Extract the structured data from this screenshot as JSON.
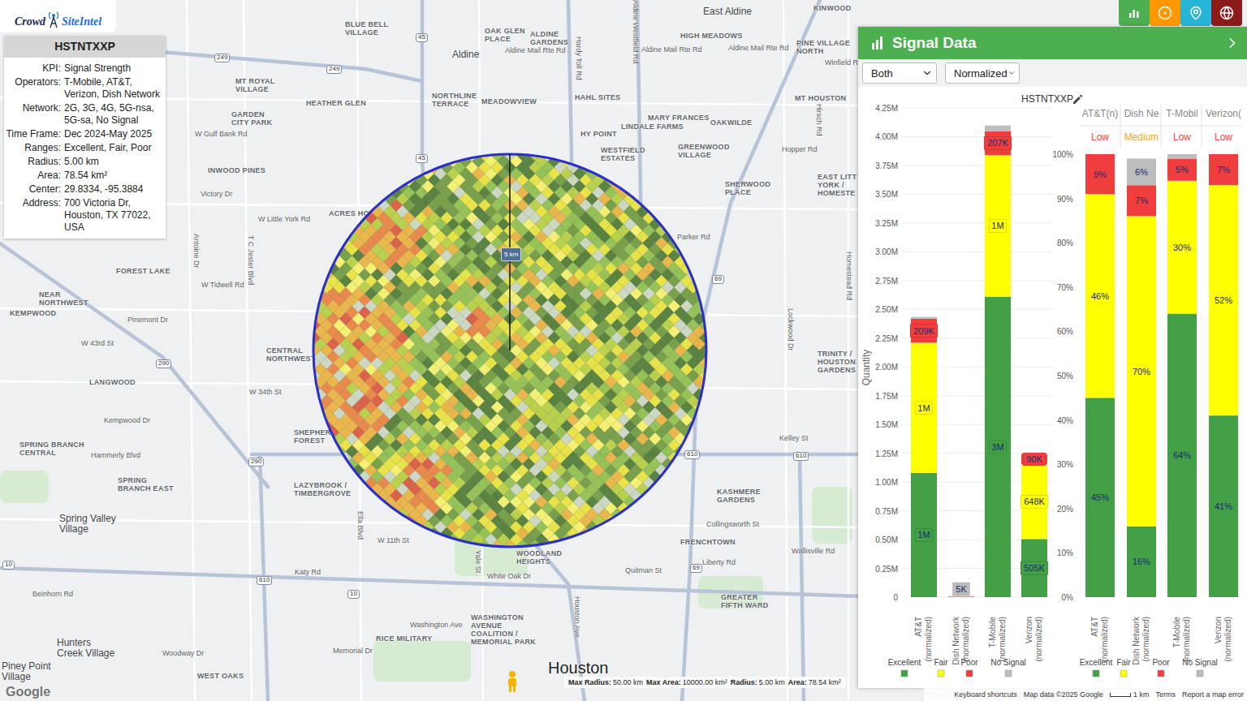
{
  "logo": {
    "parts": [
      "Crowd",
      "SiteIntel"
    ]
  },
  "info": {
    "title": "HSTNTXXP",
    "rows": [
      {
        "label": "KPI:",
        "value": "Signal Strength"
      },
      {
        "label": "Operators:",
        "value": "T-Mobile, AT&T, Verizon, Dish Network"
      },
      {
        "label": "Network:",
        "value": "2G, 3G, 4G, 5G-nsa, 5G-sa, No Signal"
      },
      {
        "label": "Time Frame:",
        "value": "Dec 2024-May 2025"
      },
      {
        "label": "Ranges:",
        "value": "Excellent, Fair, Poor"
      },
      {
        "label": "Radius:",
        "value": "5.00 km"
      },
      {
        "label": "Area:",
        "value": "78.54 km²"
      },
      {
        "label": "Center:",
        "value": "29.8334, -95.3884"
      },
      {
        "label": "Address:",
        "value": "700 Victoria Dr, Houston, TX 77022, USA"
      }
    ]
  },
  "toolbar": [
    {
      "kind": "chart",
      "color": "#4caf50"
    },
    {
      "kind": "target",
      "color": "#ff9800"
    },
    {
      "kind": "pin",
      "color": "#26b5d6"
    },
    {
      "kind": "globe",
      "color": "#8b1a1a"
    }
  ],
  "map": {
    "labels": [
      {
        "text": "East Aldine",
        "kind": "town"
      },
      {
        "text": "KINWOOD",
        "kind": "area"
      },
      {
        "text": "BLUE BELL\nVILLAGE",
        "kind": "area"
      },
      {
        "text": "OAK GLEN\nPLACE",
        "kind": "area"
      },
      {
        "text": "ALDINE\nGARDENS",
        "kind": "area"
      },
      {
        "text": "Aldine",
        "kind": "town"
      },
      {
        "text": "Aldine Mail Rte Rd",
        "kind": "road"
      },
      {
        "text": "Aldine Mail Rte Rd",
        "kind": "road"
      },
      {
        "text": "HIGH MEADOWS",
        "kind": "area"
      },
      {
        "text": "Aldine Mail Rte Rd",
        "kind": "road"
      },
      {
        "text": "PINE VILLAGE\nNORTH",
        "kind": "area"
      },
      {
        "text": "Winfield R",
        "kind": "road"
      },
      {
        "text": "MT ROYAL\nVILLAGE",
        "kind": "area"
      },
      {
        "text": "HEATHER GLEN",
        "kind": "area"
      },
      {
        "text": "NORTHLINE\nTERRACE",
        "kind": "area"
      },
      {
        "text": "MEADOWVIEW",
        "kind": "area"
      },
      {
        "text": "HAHL SITES",
        "kind": "area"
      },
      {
        "text": "MT HOUSTON",
        "kind": "area"
      },
      {
        "text": "GARDEN\nCITY PARK",
        "kind": "area"
      },
      {
        "text": "MARY FRANCES",
        "kind": "area"
      },
      {
        "text": "OAKWILDE",
        "kind": "area"
      },
      {
        "text": "LINDALE FARMS",
        "kind": "area"
      },
      {
        "text": "HY POINT",
        "kind": "area"
      },
      {
        "text": "W Gulf Bank Rd",
        "kind": "road"
      },
      {
        "text": "WESTFIELD\nESTATES",
        "kind": "area"
      },
      {
        "text": "GREENWOOD\nVILLAGE",
        "kind": "area"
      },
      {
        "text": "Hopper Rd",
        "kind": "road"
      },
      {
        "text": "INWOOD PINES",
        "kind": "area"
      },
      {
        "text": "EAST LITT\nYORK /\nHOMESTE",
        "kind": "area"
      },
      {
        "text": "SHERWOOD\nPLACE",
        "kind": "area"
      },
      {
        "text": "Victory Dr",
        "kind": "road"
      },
      {
        "text": "ACRES HO",
        "kind": "area"
      },
      {
        "text": "W Little York Rd",
        "kind": "road"
      },
      {
        "text": "Parker Rd",
        "kind": "road"
      },
      {
        "text": "FOREST LAKE",
        "kind": "area"
      },
      {
        "text": "NEAR\nNORTHWEST",
        "kind": "area"
      },
      {
        "text": "W Tidwell Rd",
        "kind": "road"
      },
      {
        "text": "KEMPWOOD",
        "kind": "area"
      },
      {
        "text": "Pinemont Dr",
        "kind": "road"
      },
      {
        "text": "W 43rd St",
        "kind": "road"
      },
      {
        "text": "CENTRAL\nNORTHWEST",
        "kind": "area"
      },
      {
        "text": "TRINITY /\nHOUSTON\nGARDENS",
        "kind": "area"
      },
      {
        "text": "LANGWOOD",
        "kind": "area"
      },
      {
        "text": "W 34th St",
        "kind": "road"
      },
      {
        "text": "Kempwood Dr",
        "kind": "road"
      },
      {
        "text": "SPRING BRANCH\nCENTRAL",
        "kind": "area"
      },
      {
        "text": "Hammerly Blvd",
        "kind": "road"
      },
      {
        "text": "SHEPHER\nFOREST",
        "kind": "area"
      },
      {
        "text": "Kelley St",
        "kind": "road"
      },
      {
        "text": "SPRING\nBRANCH EAST",
        "kind": "area"
      },
      {
        "text": "LAZYBROOK /\nTIMBERGROVE",
        "kind": "area"
      },
      {
        "text": "KASHMERE\nGARDENS",
        "kind": "area"
      },
      {
        "text": "Spring Valley\nVillage",
        "kind": "town"
      },
      {
        "text": "Collingsworth St",
        "kind": "road"
      },
      {
        "text": "W 11th St",
        "kind": "road"
      },
      {
        "text": "FRENCHTOWN",
        "kind": "area"
      },
      {
        "text": "WOODLAND\nHEIGHTS",
        "kind": "area"
      },
      {
        "text": "Wallisville Rd",
        "kind": "road"
      },
      {
        "text": "Liberty Rd",
        "kind": "road"
      },
      {
        "text": "Quitman St",
        "kind": "road"
      },
      {
        "text": "Katy Rd",
        "kind": "road"
      },
      {
        "text": "White Oak Dr",
        "kind": "road"
      },
      {
        "text": "Beinhorn Rd",
        "kind": "road"
      },
      {
        "text": "GREATER\nFIFTH WARD",
        "kind": "area"
      },
      {
        "text": "Washington Ave",
        "kind": "road"
      },
      {
        "text": "WASHINGTON\nAVENUE\nCOALITION /\nMEMORIAL PARK",
        "kind": "area"
      },
      {
        "text": "RICE MILITARY",
        "kind": "area"
      },
      {
        "text": "Memorial Dr",
        "kind": "road"
      },
      {
        "text": "Hunters\nCreek Village",
        "kind": "town"
      },
      {
        "text": "Woodway Dr",
        "kind": "road"
      },
      {
        "text": "Piney Point\nVillage",
        "kind": "town"
      },
      {
        "text": "WEST OAKS",
        "kind": "area"
      },
      {
        "text": "Houston",
        "kind": "city"
      },
      {
        "text": "Aldine Westfield Rd",
        "kind": "road-v"
      },
      {
        "text": "Hirsch Rd",
        "kind": "road-v"
      },
      {
        "text": "Lockwood Dr",
        "kind": "road-v"
      },
      {
        "text": "Homestead Rd",
        "kind": "road-v"
      },
      {
        "text": "Antoine Dr",
        "kind": "road-v"
      },
      {
        "text": "T C Jester Blvd",
        "kind": "road-v"
      },
      {
        "text": "Ella Blvd",
        "kind": "road-v"
      },
      {
        "text": "Yale St",
        "kind": "road-v"
      },
      {
        "text": "Houston Ave",
        "kind": "road-v"
      },
      {
        "text": "Hardy Toll Rd",
        "kind": "road-v"
      },
      {
        "text": "45",
        "kind": "shield"
      },
      {
        "text": "249",
        "kind": "shield"
      },
      {
        "text": "249",
        "kind": "shield"
      },
      {
        "text": "45",
        "kind": "shield"
      },
      {
        "text": "69",
        "kind": "shield"
      },
      {
        "text": "610",
        "kind": "shield"
      },
      {
        "text": "610",
        "kind": "shield"
      },
      {
        "text": "610",
        "kind": "shield"
      },
      {
        "text": "10",
        "kind": "shield"
      },
      {
        "text": "290",
        "kind": "shield"
      },
      {
        "text": "290",
        "kind": "shield"
      },
      {
        "text": "69",
        "kind": "shield"
      },
      {
        "text": "10",
        "kind": "shield"
      }
    ],
    "radius_label": "5 km",
    "google": "Google",
    "scale": [
      {
        "label": "Max Radius:",
        "value": "50.00 km"
      },
      {
        "label": "Max Area:",
        "value": "10000.00 km²"
      },
      {
        "label": "Radius:",
        "value": "5.00 km"
      },
      {
        "label": "Area:",
        "value": "78.54 km²"
      }
    ],
    "attribution": [
      "Keyboard shortcuts",
      "Map data ©2025 Google",
      "1 km",
      "Terms",
      "Report a map error"
    ]
  },
  "heatmap": {
    "palette": [
      "#4f7a32",
      "#6f9a3c",
      "#8fbf4a",
      "#b5cf3e",
      "#e6e23a",
      "#f3f06a",
      "#e9b23e",
      "#e8823e",
      "#d9573b",
      "#c9d6bf"
    ]
  },
  "panel": {
    "title": "Signal Data",
    "selects": [
      {
        "value": "Both"
      },
      {
        "value": "Normalized"
      }
    ],
    "categories": [
      "AT&T\n(normalized)",
      "Dish Network\n(normalized)",
      "T-Mobile\n(normalized)",
      "Verizon\n(normalized)"
    ],
    "legend": [
      {
        "name": "Excellent",
        "color": "#43a047"
      },
      {
        "name": "Fair",
        "color": "#ffff00"
      },
      {
        "name": "Poor",
        "color": "#f03e3e"
      },
      {
        "name": "No Signal",
        "color": "#bdbdbd"
      }
    ],
    "quantity_chart": {
      "title": "HSTNTXXP",
      "axis_title": "Quantity",
      "max": 4.25,
      "ticks": [
        "0",
        "0.25M",
        "0.50M",
        "0.75M",
        "1.00M",
        "1.25M",
        "1.50M",
        "1.75M",
        "2.00M",
        "2.25M",
        "2.50M",
        "2.75M",
        "3.00M",
        "3.25M",
        "3.50M",
        "3.75M",
        "4.00M",
        "4.25M"
      ],
      "series": [
        {
          "values": [
            1.08,
            0.002,
            2.61,
            0.505
          ],
          "labels": [
            "1M",
            "",
            "3M",
            "505K"
          ]
        },
        {
          "values": [
            1.13,
            0.0015,
            1.23,
            0.648
          ],
          "labels": [
            "1M",
            "",
            "1M",
            "648K"
          ]
        },
        {
          "values": [
            0.209,
            0.0008,
            0.207,
            0.09
          ],
          "labels": [
            "209K",
            "",
            "207K",
            "90K"
          ]
        },
        {
          "values": [
            0.015,
            0.0007,
            0.05,
            0.01
          ],
          "labels": [
            "",
            "5K",
            "",
            ""
          ]
        }
      ]
    },
    "percent_chart": {
      "headers": [
        "AT&T(n)",
        "Dish Ne",
        "T-Mobil",
        "Verizon("
      ],
      "ratings": [
        {
          "text": "Low",
          "color": "#f44336"
        },
        {
          "text": "Medium",
          "color": "#f5a623"
        },
        {
          "text": "Low",
          "color": "#f44336"
        },
        {
          "text": "Low",
          "color": "#f44336"
        }
      ],
      "ticks": [
        "0%",
        "10%",
        "20%",
        "30%",
        "40%",
        "50%",
        "60%",
        "70%",
        "80%",
        "90%",
        "100%"
      ],
      "series": [
        {
          "values": [
            45,
            16,
            64,
            41
          ],
          "labels": [
            "45%",
            "16%",
            "64%",
            "41%"
          ]
        },
        {
          "values": [
            46,
            70,
            30,
            52
          ],
          "labels": [
            "46%",
            "70%",
            "30%",
            "52%"
          ]
        },
        {
          "values": [
            9,
            7,
            5,
            7
          ],
          "labels": [
            "9%",
            "7%",
            "5%",
            "7%"
          ]
        },
        {
          "values": [
            0,
            6,
            1,
            0
          ],
          "labels": [
            "",
            "6%",
            "",
            ""
          ]
        }
      ]
    }
  }
}
